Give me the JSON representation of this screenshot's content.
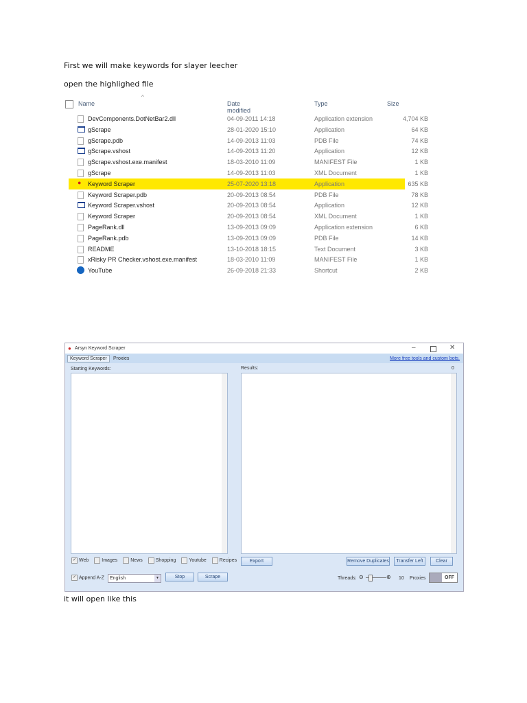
{
  "doc": {
    "line1": "First we will make keywords for slayer leecher",
    "line2": "open the highlighed file",
    "line3": "it will open like this"
  },
  "explorer": {
    "headers": {
      "name": "Name",
      "date": "Date modified",
      "type": "Type",
      "size": "Size"
    },
    "rows": [
      {
        "name": "DevComponents.DotNetBar2.dll",
        "date": "04-09-2011 14:18",
        "type": "Application extension",
        "size": "4,704 KB",
        "icon": "dll"
      },
      {
        "name": "gScrape",
        "date": "28-01-2020 15:10",
        "type": "Application",
        "size": "64 KB",
        "icon": "app"
      },
      {
        "name": "gScrape.pdb",
        "date": "14-09-2013 11:03",
        "type": "PDB File",
        "size": "74 KB",
        "icon": "file"
      },
      {
        "name": "gScrape.vshost",
        "date": "14-09-2013 11:20",
        "type": "Application",
        "size": "12 KB",
        "icon": "app"
      },
      {
        "name": "gScrape.vshost.exe.manifest",
        "date": "18-03-2010 11:09",
        "type": "MANIFEST File",
        "size": "1 KB",
        "icon": "file"
      },
      {
        "name": "gScrape",
        "date": "14-09-2013 11:03",
        "type": "XML Document",
        "size": "1 KB",
        "icon": "file"
      },
      {
        "name": "Keyword Scraper",
        "date": "25-07-2020 13:18",
        "type": "Application",
        "size": "635 KB",
        "icon": "scraper",
        "highlighted": true
      },
      {
        "name": "Keyword Scraper.pdb",
        "date": "20-09-2013 08:54",
        "type": "PDB File",
        "size": "78 KB",
        "icon": "file"
      },
      {
        "name": "Keyword Scraper.vshost",
        "date": "20-09-2013 08:54",
        "type": "Application",
        "size": "12 KB",
        "icon": "app"
      },
      {
        "name": "Keyword Scraper",
        "date": "20-09-2013 08:54",
        "type": "XML Document",
        "size": "1 KB",
        "icon": "file"
      },
      {
        "name": "PageRank.dll",
        "date": "13-09-2013 09:09",
        "type": "Application extension",
        "size": "6 KB",
        "icon": "dll"
      },
      {
        "name": "PageRank.pdb",
        "date": "13-09-2013 09:09",
        "type": "PDB File",
        "size": "14 KB",
        "icon": "file"
      },
      {
        "name": "README",
        "date": "13-10-2018 18:15",
        "type": "Text Document",
        "size": "3 KB",
        "icon": "text"
      },
      {
        "name": "xRisky PR Checker.vshost.exe.manifest",
        "date": "18-03-2010 11:09",
        "type": "MANIFEST File",
        "size": "1 KB",
        "icon": "file"
      },
      {
        "name": "YouTube",
        "date": "26-09-2018 21:33",
        "type": "Shortcut",
        "size": "2 KB",
        "icon": "shortcut"
      }
    ]
  },
  "app": {
    "title": "Arsyn Keyword Scraper",
    "tabs": [
      "Keyword Scraper",
      "Proxies"
    ],
    "link": "More free tools and custom bots.",
    "starting_label": "Starting Keywords:",
    "results_label": "Results:",
    "results_count": "0",
    "sources": [
      {
        "label": "Web",
        "checked": true
      },
      {
        "label": "Images",
        "checked": false
      },
      {
        "label": "News",
        "checked": false
      },
      {
        "label": "Shopping",
        "checked": false
      },
      {
        "label": "Youtube",
        "checked": false
      },
      {
        "label": "Recipes",
        "checked": false
      }
    ],
    "append_label": "Append A-Z",
    "language": "English",
    "stop": "Stop",
    "scrape": "Scrape",
    "export": "Export",
    "remove_dup": "Remove Duplicates",
    "transfer_left": "Transfer Left",
    "clear": "Clear",
    "threads_label": "Threads:",
    "threads_value": "10",
    "proxies_label": "Proxies",
    "proxies_toggle": "OFF"
  }
}
